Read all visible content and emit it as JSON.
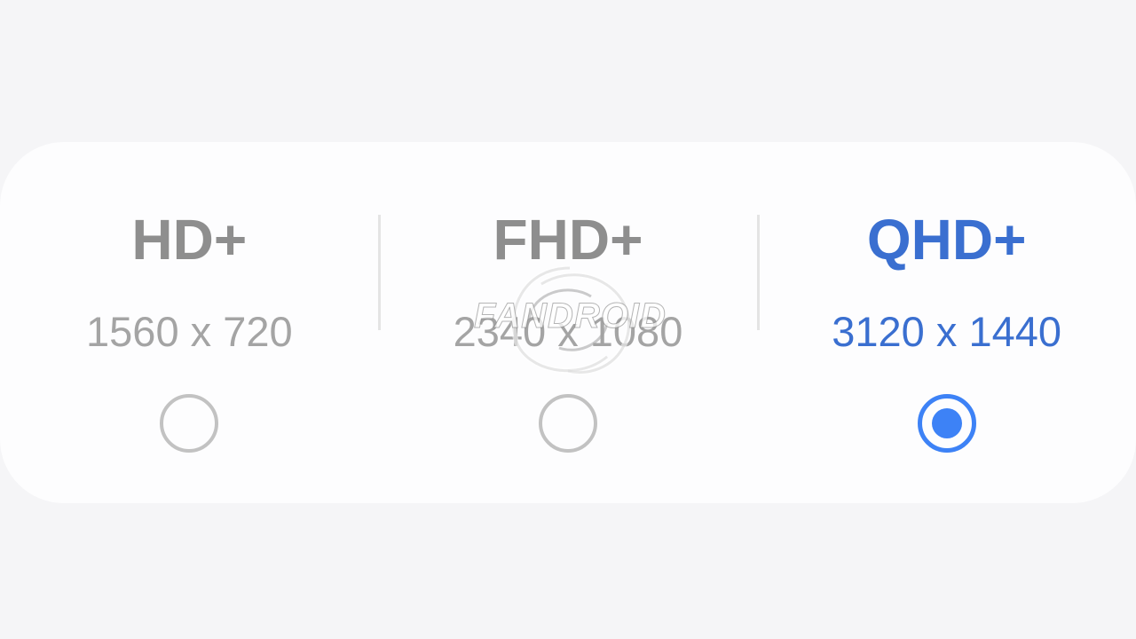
{
  "colors": {
    "accent": "#3a6fd0",
    "radio": "#3d82f6",
    "inactive_text": "#8e8e8e",
    "inactive_radio": "#c2c2c2"
  },
  "options": [
    {
      "name": "HD+",
      "dimensions": "1560 x 720",
      "selected": false
    },
    {
      "name": "FHD+",
      "dimensions": "2340 x 1080",
      "selected": false
    },
    {
      "name": "QHD+",
      "dimensions": "3120 x 1440",
      "selected": true
    }
  ],
  "watermark": {
    "text": "FANDROID",
    "icon": "watermark-swirl-icon"
  }
}
